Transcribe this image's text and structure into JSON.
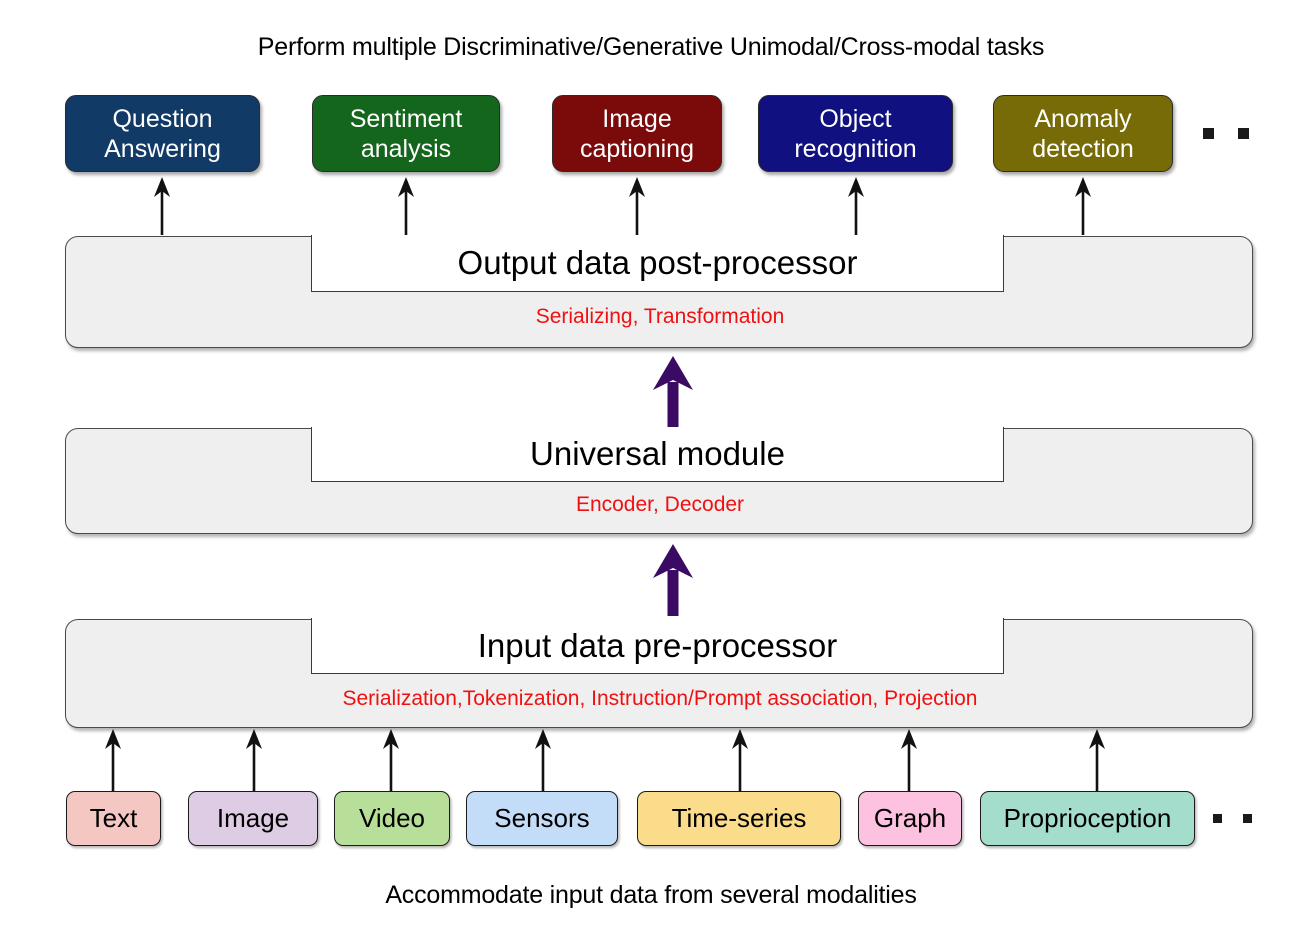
{
  "title_caption": "Perform multiple Discriminative/Generative Unimodal/Cross-modal tasks",
  "bottom_caption": "Accommodate input data from several modalities",
  "tasks": [
    {
      "line1": "Question",
      "line2": "Answering",
      "color": "#123A66"
    },
    {
      "line1": "Sentiment",
      "line2": "analysis",
      "color": "#14661C"
    },
    {
      "line1": "Image",
      "line2": "captioning",
      "color": "#7B0A0A"
    },
    {
      "line1": "Object",
      "line2": "recognition",
      "color": "#101080"
    },
    {
      "line1": "Anomaly",
      "line2": "detection",
      "color": "#766B07"
    }
  ],
  "task_ellipsis": "two-square-ellipsis",
  "blocks": [
    {
      "name": "output-post-processor",
      "label": "Output data post-processor",
      "subtitle": "Serializing, Transformation"
    },
    {
      "name": "universal-module",
      "label": "Universal module",
      "subtitle": "Encoder, Decoder"
    },
    {
      "name": "input-pre-processor",
      "label": "Input data pre-processor",
      "subtitle": "Serialization,Tokenization, Instruction/Prompt association, Projection"
    }
  ],
  "modalities": [
    {
      "label": "Text",
      "color": "#F4C7C3"
    },
    {
      "label": "Image",
      "color": "#DECCE5"
    },
    {
      "label": "Video",
      "color": "#B7DF9A"
    },
    {
      "label": "Sensors",
      "color": "#C3DCF7"
    },
    {
      "label": "Time-series",
      "color": "#FBDC8B"
    },
    {
      "label": "Graph",
      "color": "#FCC2E0"
    },
    {
      "label": "Proprioception",
      "color": "#A4DDCC"
    }
  ],
  "modality_ellipsis": "two-square-ellipsis",
  "colors": {
    "block_fill": "#EFEFEF",
    "block_border": "#4A4A4A",
    "subtitle_red": "#EF1111",
    "thick_arrow_purple": "#3B0B63",
    "thin_arrow_black": "#111111"
  },
  "arrows": {
    "task_arrows": "five-thin-black-up-arrows",
    "modality_arrows": "seven-thin-black-up-arrows",
    "stage_arrows": "two-thick-purple-up-arrows"
  }
}
